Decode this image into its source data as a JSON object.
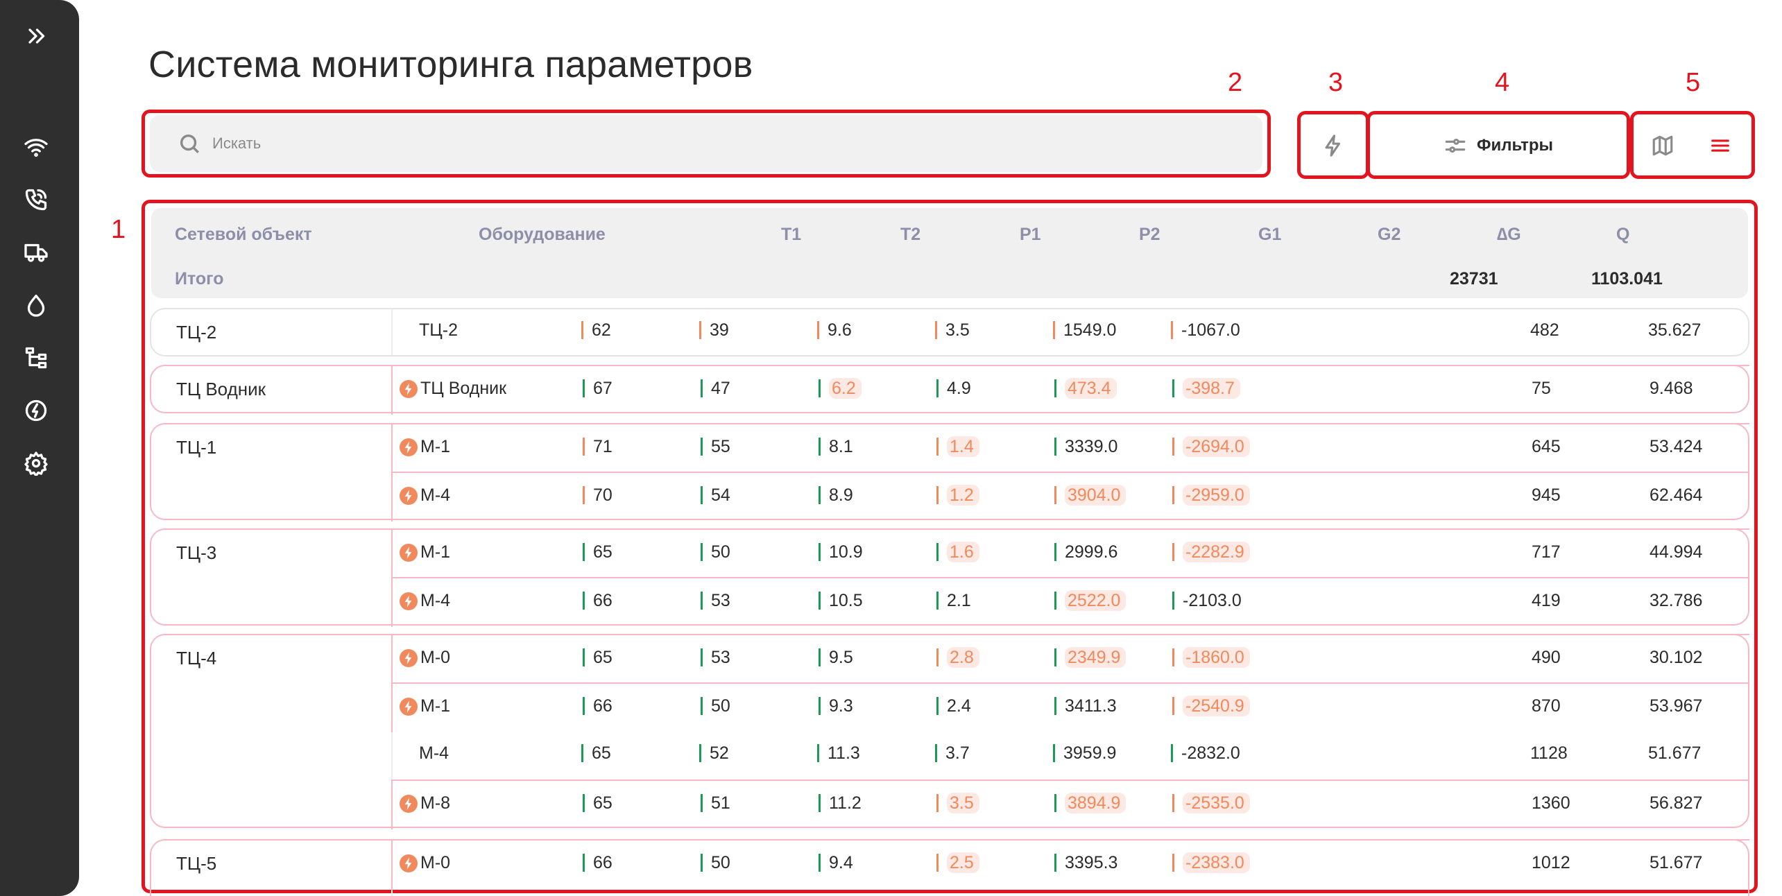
{
  "page_title": "Система мониторинга параметров",
  "search": {
    "placeholder": "Искать"
  },
  "filters_label": "Фильтры",
  "annotations": [
    "1",
    "2",
    "3",
    "4",
    "5"
  ],
  "sidebar_icons": [
    "expand-icon",
    "wifi-icon",
    "phone-icon",
    "truck-icon",
    "drop-icon",
    "tree-icon",
    "bolt-circle-icon",
    "gear-icon"
  ],
  "table": {
    "headers": [
      "Сетевой объект",
      "Оборудование",
      "T1",
      "T2",
      "P1",
      "P2",
      "G1",
      "G2",
      "∆G",
      "Q"
    ],
    "total_label": "Итого",
    "total_dg": "23731",
    "total_q": "1103.041",
    "groups": [
      {
        "name": "ТЦ-2",
        "rows": [
          {
            "eq": "ТЦ-2",
            "bolt": false,
            "t1": "62",
            "t2": "39",
            "p1": "9.6",
            "p2": "3.5",
            "g1": "1549.0",
            "g2": "-1067.0",
            "dg": "482",
            "q": "35.627"
          }
        ]
      },
      {
        "name": "ТЦ Водник",
        "rows": [
          {
            "eq": "ТЦ Водник",
            "bolt": true,
            "t1": "67",
            "t2": "47",
            "p1": "6.2",
            "p2": "4.9",
            "g1": "473.4",
            "g2": "-398.7",
            "dg": "75",
            "q": "9.468"
          }
        ]
      },
      {
        "name": "ТЦ-1",
        "rows": [
          {
            "eq": "М-1",
            "bolt": true,
            "t1": "71",
            "t2": "55",
            "p1": "8.1",
            "p2": "1.4",
            "g1": "3339.0",
            "g2": "-2694.0",
            "dg": "645",
            "q": "53.424"
          },
          {
            "eq": "М-4",
            "bolt": true,
            "t1": "70",
            "t2": "54",
            "p1": "8.9",
            "p2": "1.2",
            "g1": "3904.0",
            "g2": "-2959.0",
            "dg": "945",
            "q": "62.464"
          }
        ]
      },
      {
        "name": "ТЦ-3",
        "rows": [
          {
            "eq": "М-1",
            "bolt": true,
            "t1": "65",
            "t2": "50",
            "p1": "10.9",
            "p2": "1.6",
            "g1": "2999.6",
            "g2": "-2282.9",
            "dg": "717",
            "q": "44.994"
          },
          {
            "eq": "М-4",
            "bolt": true,
            "t1": "66",
            "t2": "53",
            "p1": "10.5",
            "p2": "2.1",
            "g1": "2522.0",
            "g2": "-2103.0",
            "dg": "419",
            "q": "32.786"
          }
        ]
      },
      {
        "name": "ТЦ-4",
        "rows": [
          {
            "eq": "М-0",
            "bolt": true,
            "t1": "65",
            "t2": "53",
            "p1": "9.5",
            "p2": "2.8",
            "g1": "2349.9",
            "g2": "-1860.0",
            "dg": "490",
            "q": "30.102"
          },
          {
            "eq": "М-1",
            "bolt": true,
            "t1": "66",
            "t2": "50",
            "p1": "9.3",
            "p2": "2.4",
            "g1": "3411.3",
            "g2": "-2540.9",
            "dg": "870",
            "q": "53.967"
          },
          {
            "eq": "М-4",
            "bolt": false,
            "t1": "65",
            "t2": "52",
            "p1": "11.3",
            "p2": "3.7",
            "g1": "3959.9",
            "g2": "-2832.0",
            "dg": "1128",
            "q": "51.677"
          },
          {
            "eq": "М-8",
            "bolt": true,
            "t1": "65",
            "t2": "51",
            "p1": "11.2",
            "p2": "3.5",
            "g1": "3894.9",
            "g2": "-2535.0",
            "dg": "1360",
            "q": "56.827"
          }
        ]
      },
      {
        "name": "ТЦ-5",
        "rows": [
          {
            "eq": "М-0",
            "bolt": true,
            "t1": "66",
            "t2": "50",
            "p1": "9.4",
            "p2": "2.5",
            "g1": "3395.3",
            "g2": "-2383.0",
            "dg": "1012",
            "q": "51.677"
          }
        ]
      }
    ]
  }
}
